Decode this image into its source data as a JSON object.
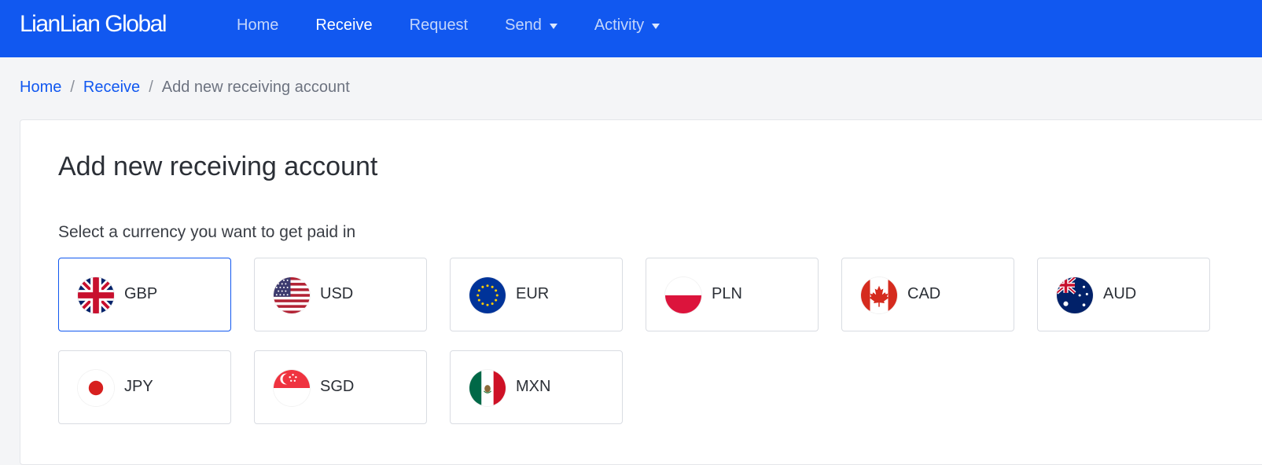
{
  "brand": "LianLian Global",
  "nav": {
    "home": "Home",
    "receive": "Receive",
    "request": "Request",
    "send": "Send",
    "activity": "Activity"
  },
  "breadcrumb": {
    "home": "Home",
    "receive": "Receive",
    "current": "Add new receiving account",
    "separator": "/"
  },
  "page": {
    "title": "Add new receiving account",
    "subtitle": "Select a currency you want to get paid in"
  },
  "currencies": [
    {
      "code": "GBP",
      "flag": "uk-flag-icon",
      "selected": true
    },
    {
      "code": "USD",
      "flag": "us-flag-icon",
      "selected": false
    },
    {
      "code": "EUR",
      "flag": "eu-flag-icon",
      "selected": false
    },
    {
      "code": "PLN",
      "flag": "poland-flag-icon",
      "selected": false
    },
    {
      "code": "CAD",
      "flag": "canada-flag-icon",
      "selected": false
    },
    {
      "code": "AUD",
      "flag": "australia-flag-icon",
      "selected": false
    },
    {
      "code": "JPY",
      "flag": "japan-flag-icon",
      "selected": false
    },
    {
      "code": "SGD",
      "flag": "singapore-flag-icon",
      "selected": false
    },
    {
      "code": "MXN",
      "flag": "mexico-flag-icon",
      "selected": false
    }
  ],
  "colors": {
    "primary": "#1158f0",
    "page_bg": "#f4f5f7",
    "selected_border": "#1158f0"
  }
}
